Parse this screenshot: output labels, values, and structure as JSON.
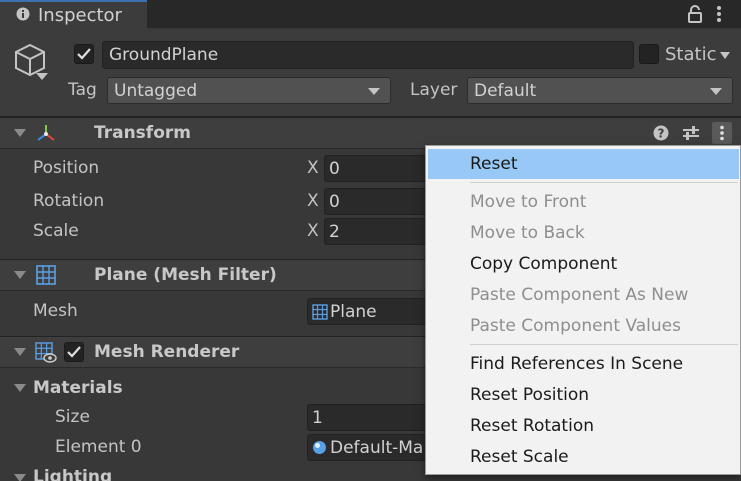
{
  "tab": {
    "title": "Inspector"
  },
  "header": {
    "object_name": "GroundPlane",
    "static_label": "Static",
    "tag_label": "Tag",
    "tag_value": "Untagged",
    "layer_label": "Layer",
    "layer_value": "Default"
  },
  "transform": {
    "title": "Transform",
    "rows": [
      {
        "label": "Position",
        "axis": "X",
        "value": "0"
      },
      {
        "label": "Rotation",
        "axis": "X",
        "value": "0"
      },
      {
        "label": "Scale",
        "axis": "X",
        "value": "2"
      }
    ]
  },
  "mesh_filter": {
    "title": "Plane (Mesh Filter)",
    "mesh_label": "Mesh",
    "mesh_value": "Plane"
  },
  "mesh_renderer": {
    "title": "Mesh Renderer",
    "materials_label": "Materials",
    "size_label": "Size",
    "size_value": "1",
    "element0_label": "Element 0",
    "element0_value": "Default-Ma",
    "lighting_label": "Lighting"
  },
  "context_menu": {
    "items": [
      {
        "label": "Reset",
        "state": "highlighted"
      },
      {
        "label": "Move to Front",
        "state": "disabled"
      },
      {
        "label": "Move to Back",
        "state": "disabled"
      },
      {
        "label": "Copy Component",
        "state": "enabled"
      },
      {
        "label": "Paste Component As New",
        "state": "disabled"
      },
      {
        "label": "Paste Component Values",
        "state": "disabled"
      },
      {
        "label": "Find References In Scene",
        "state": "enabled"
      },
      {
        "label": "Reset Position",
        "state": "enabled"
      },
      {
        "label": "Reset Rotation",
        "state": "enabled"
      },
      {
        "label": "Reset Scale",
        "state": "enabled"
      }
    ]
  },
  "colors": {
    "highlight": "#98c8f5",
    "panel": "#383838",
    "menu_bg": "#f2f2f2"
  }
}
